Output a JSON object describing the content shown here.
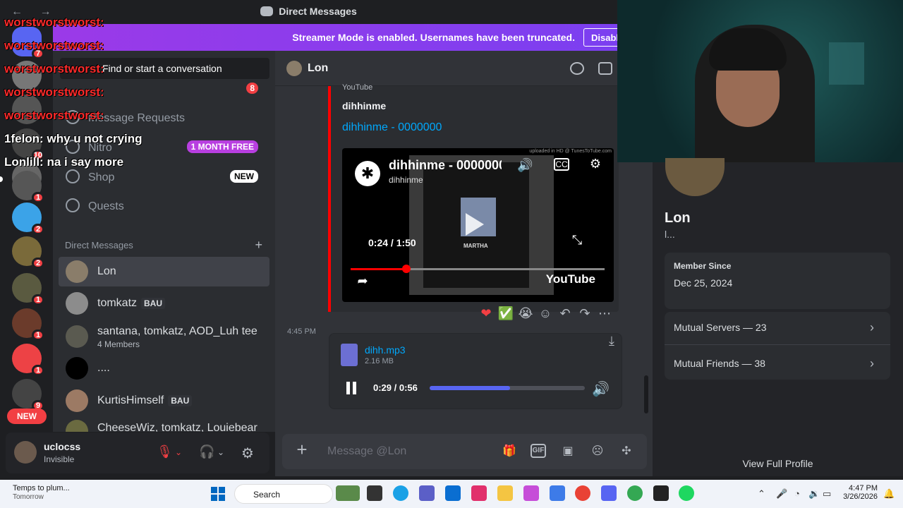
{
  "window": {
    "title": "Direct Messages",
    "nav_glyphs": "← →"
  },
  "banner": {
    "text": "Streamer Mode is enabled. Usernames have been truncated.",
    "button": "Disable"
  },
  "server_rail": {
    "badges": [
      "7",
      "",
      "",
      "10",
      "",
      "",
      "1",
      "2",
      "2",
      "1",
      "1",
      "1",
      "9"
    ],
    "new_label": "NEW"
  },
  "overlay_chat": [
    {
      "user": "worstworstworst:",
      "message": ""
    },
    {
      "user": "worstworstworst:",
      "message": ""
    },
    {
      "user": "worstworstworst:",
      "message": ""
    },
    {
      "user": "worstworstworst:",
      "message": ""
    },
    {
      "user": "worstworstworst:",
      "message": ""
    },
    {
      "user": "1felon:",
      "message": "why u not crying"
    },
    {
      "user": "Lonlill:",
      "message": "na i say more"
    }
  ],
  "dm_sidebar": {
    "search_placeholder": "Find or start a conversation",
    "friends_badge": "8",
    "nav": {
      "message_requests": "Message Requests",
      "nitro": "Nitro",
      "nitro_tag": "1 MONTH FREE",
      "shop": "Shop",
      "shop_tag": "NEW",
      "quests": "Quests"
    },
    "section_title": "Direct Messages",
    "add_symbol": "+",
    "conversations": [
      {
        "name": "Lon",
        "tag": "",
        "sub": ""
      },
      {
        "name": "tomkatz",
        "tag": "BAU",
        "sub": ""
      },
      {
        "name": "santana, tomkatz, AOD_Luh tee",
        "tag": "",
        "sub": "4 Members"
      },
      {
        "name": "....",
        "tag": "",
        "sub": ""
      },
      {
        "name": "KurtisHimself",
        "tag": "BAU",
        "sub": ""
      },
      {
        "name": "CheeseWiz, tomkatz, Louiebear",
        "tag": "",
        "sub": ""
      }
    ]
  },
  "user_panel": {
    "username": "uclocss",
    "status": "Invisible"
  },
  "chat": {
    "recipient": "Lon",
    "embed": {
      "provider": "YouTube",
      "author": "dihhinme",
      "title": "dihhinme - 0000000",
      "video_title": "dihhinme - 0000000",
      "video_channel": "dihhinme",
      "time": "0:24 / 1:50",
      "progress": 0.22,
      "uploaded_note": "uploaded in HD @ TunesToTube.com",
      "logo_text": "YouTube",
      "shirt_text": "MARTHA"
    },
    "reactions": [
      "❤",
      "✅",
      "😭"
    ],
    "message_actions": [
      "☺",
      "↶",
      "↷",
      "⋯"
    ],
    "timestamp": "4:45 PM",
    "attachment": {
      "filename": "dihh.mp3",
      "size": "2.16 MB",
      "time": "0:29 / 0:56",
      "progress": 0.52
    },
    "composer_placeholder": "Message @Lon"
  },
  "profile": {
    "name": "Lon",
    "sub": "l...",
    "member_since_label": "Member Since",
    "member_since": "Dec 25, 2024",
    "mutual_servers": "Mutual Servers — 23",
    "mutual_friends": "Mutual Friends — 38",
    "view_full": "View Full Profile"
  },
  "taskbar": {
    "weather_title": "Temps to plum...",
    "weather_sub": "Tomorrow",
    "search": "Search",
    "time": "4:47 PM",
    "date": "3/26/2026"
  }
}
